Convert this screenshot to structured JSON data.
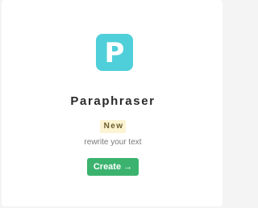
{
  "card": {
    "icon": {
      "name": "paraphraser-p-icon",
      "letter": "P",
      "color": "#4fcfd9"
    },
    "title": "Paraphraser",
    "badge": "New",
    "subtitle": "rewrite your text",
    "create_label": "Create →",
    "button_color": "#3bb36f"
  }
}
